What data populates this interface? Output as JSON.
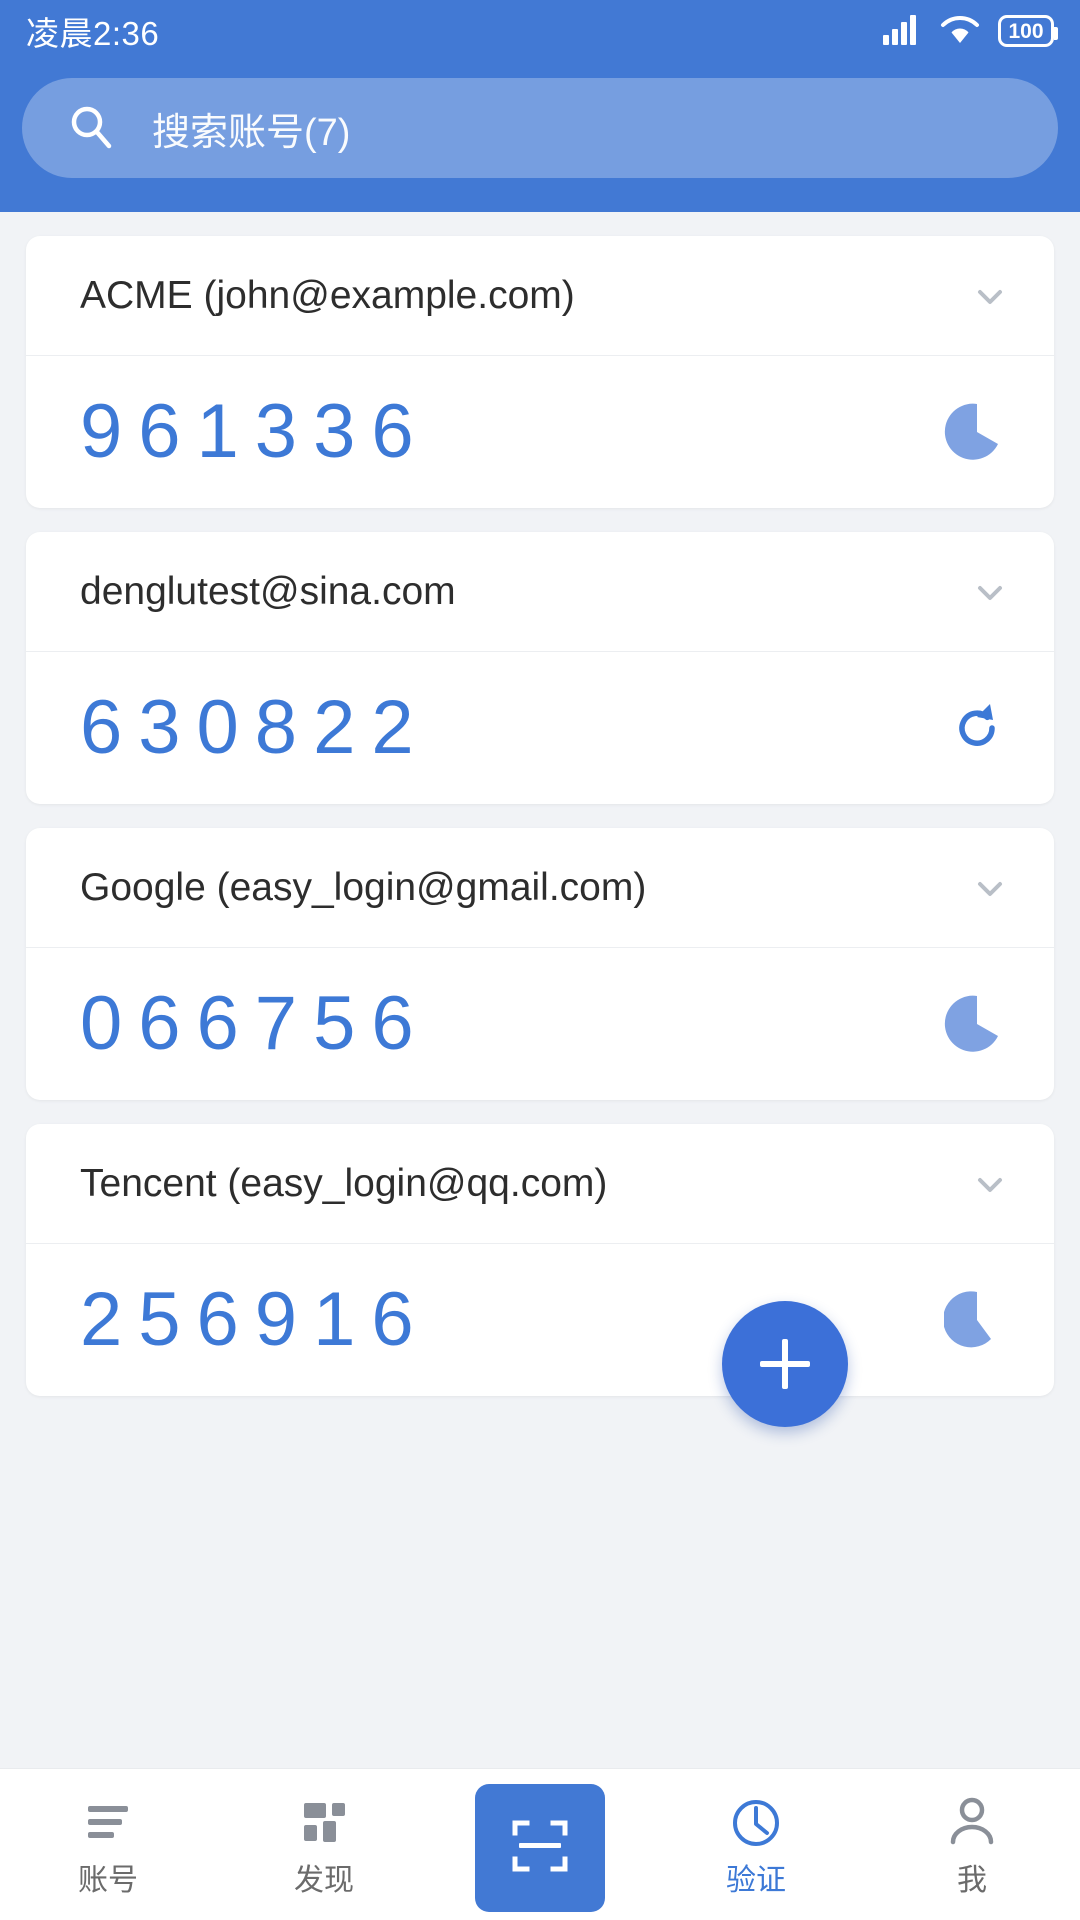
{
  "status_bar": {
    "time": "凌晨2:36",
    "battery_level": "100",
    "icons": [
      "signal-icon",
      "wifi-icon",
      "battery-icon"
    ]
  },
  "header": {
    "background_color": "#4279d4",
    "search": {
      "icon": "search-icon",
      "placeholder": "搜索账号(7)",
      "value": ""
    }
  },
  "accounts": [
    {
      "title": "ACME (john@example.com)",
      "code": "961336",
      "expand_icon": "chevron-down-icon",
      "indicator": "countdown-pie-icon",
      "countdown_fraction": 0.62
    },
    {
      "title": "denglutest@sina.com",
      "code": "630822",
      "expand_icon": "chevron-down-icon",
      "indicator": "refresh-icon",
      "countdown_fraction": 0
    },
    {
      "title": "Google (easy_login@gmail.com)",
      "code": "066756",
      "expand_icon": "chevron-down-icon",
      "indicator": "countdown-pie-icon",
      "countdown_fraction": 0.62
    },
    {
      "title": "Tencent (easy_login@qq.com)",
      "code": "256916",
      "expand_icon": "chevron-down-icon",
      "indicator": "countdown-pie-icon",
      "countdown_fraction": 0.52
    }
  ],
  "fab": {
    "icon": "plus-icon",
    "label": "+",
    "color": "#3c70d8"
  },
  "bottom_nav": {
    "active_index": 3,
    "items": [
      {
        "label": "账号",
        "icon": "list-icon",
        "active": false
      },
      {
        "label": "发现",
        "icon": "grid-icon",
        "active": false
      },
      {
        "label": "",
        "icon": "qr-scan-icon",
        "active": false
      },
      {
        "label": "验证",
        "icon": "clock-icon",
        "active": true
      },
      {
        "label": "我",
        "icon": "person-icon",
        "active": false
      }
    ]
  },
  "colors": {
    "primary": "#4279d4",
    "code_blue": "#3d79d6",
    "indicator_blue": "#7fa2e2",
    "page_bg": "#f1f3f6",
    "card_bg": "#ffffff",
    "text_dark": "#2d2d2d",
    "text_muted": "#6b6b6b"
  }
}
